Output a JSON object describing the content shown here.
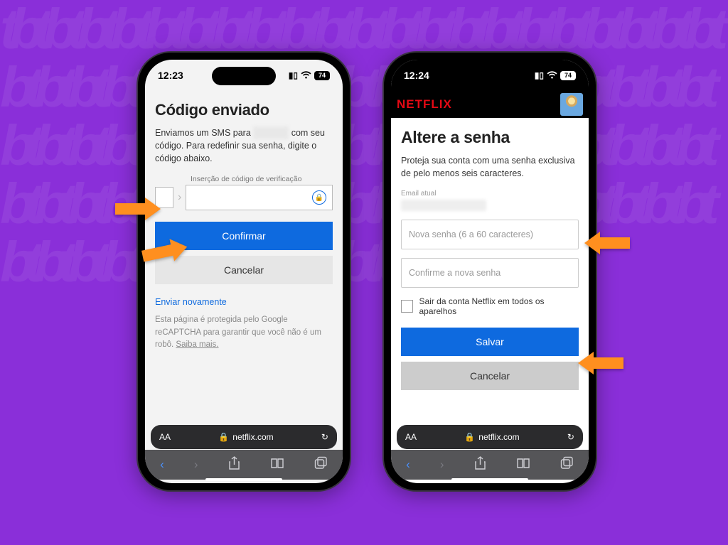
{
  "colors": {
    "bg": "#8a2fd9",
    "primaryButton": "#0e6adf",
    "netflixRed": "#e50914",
    "arrow": "#ff8f1f"
  },
  "leftPhone": {
    "status": {
      "time": "12:23",
      "battery": "74"
    },
    "title": "Código enviado",
    "desc_pre": "Enviamos um SMS para ",
    "desc_masked": "xxxxxxxx",
    "desc_post": " com seu código. Para redefinir sua senha, digite o código abaixo.",
    "codeLabel": "Inserção de código de verificação",
    "confirm": "Confirmar",
    "cancel": "Cancelar",
    "resend": "Enviar novamente",
    "recaptcha_pre": "Esta página é protegida pelo Google reCAPTCHA para garantir que você não é um robô. ",
    "recaptcha_link": "Saiba mais.",
    "urlText": "netflix.com",
    "aa": "AA"
  },
  "rightPhone": {
    "status": {
      "time": "12:24",
      "battery": "74"
    },
    "brand": "NETFLIX",
    "title": "Altere a senha",
    "desc": "Proteja sua conta com uma senha exclusiva de pelo menos seis caracteres.",
    "emailLabel": "Email atual",
    "newPassPlaceholder": "Nova senha (6 a 60 caracteres)",
    "confirmPassPlaceholder": "Confirme a nova senha",
    "signoutAll": "Sair da conta Netflix em todos os aparelhos",
    "save": "Salvar",
    "cancel": "Cancelar",
    "urlText": "netflix.com",
    "aa": "AA"
  }
}
